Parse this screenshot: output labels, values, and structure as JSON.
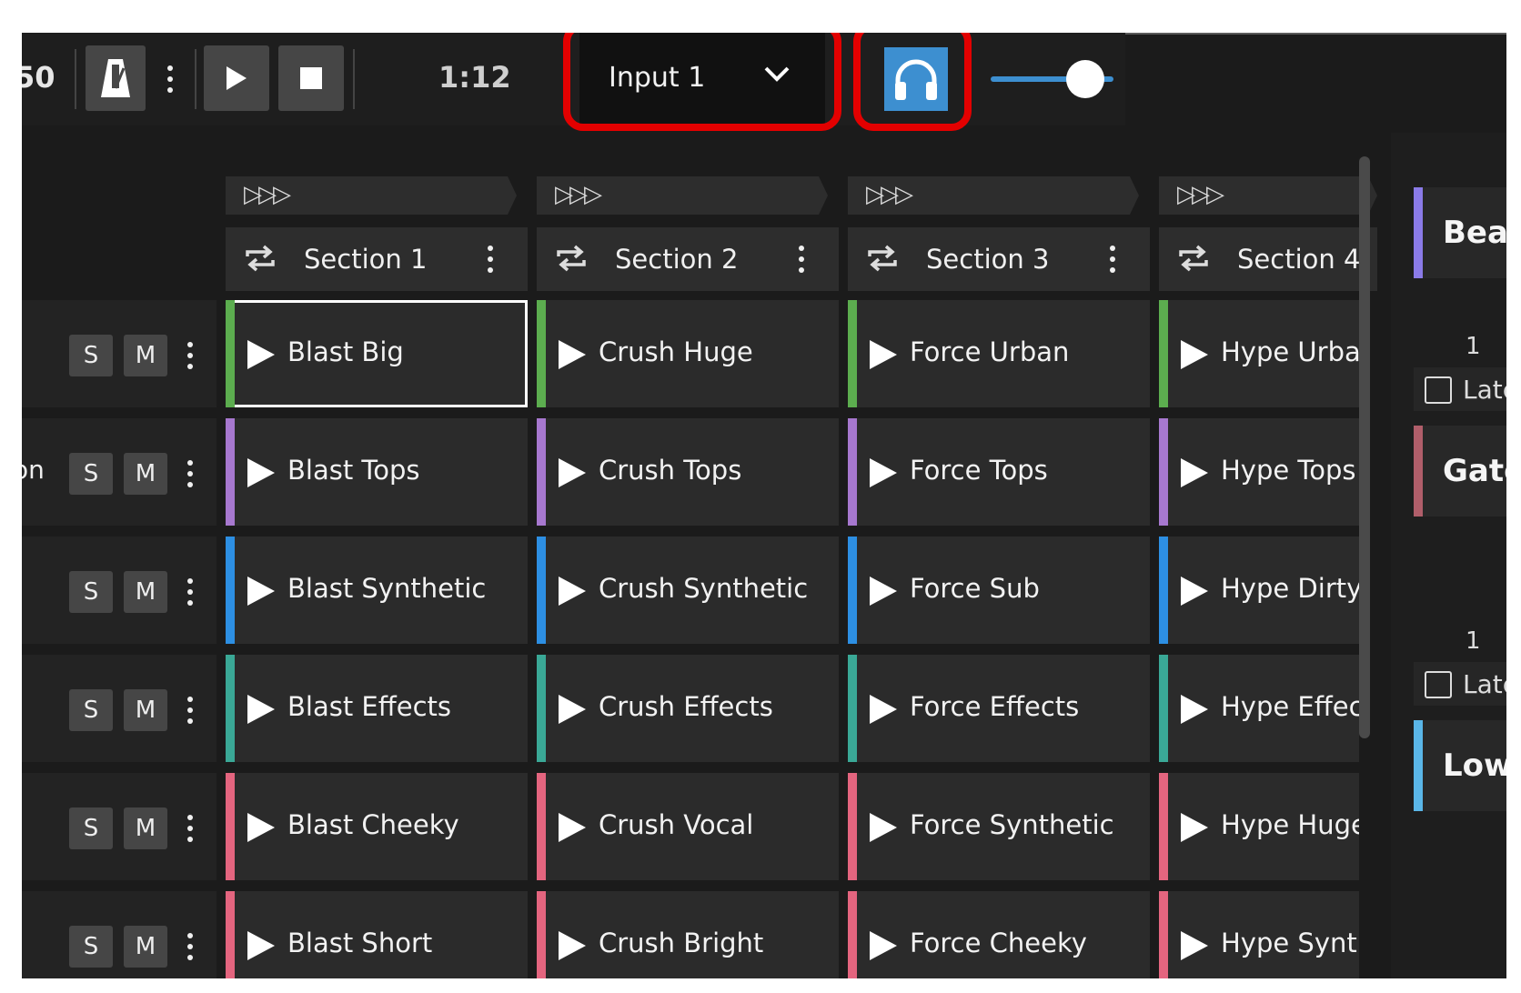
{
  "transport": {
    "tempo_partial": "50",
    "time": "1:12"
  },
  "input_select": {
    "value": "Input 1"
  },
  "sections": [
    {
      "label": "Section 1"
    },
    {
      "label": "Section 2"
    },
    {
      "label": "Section 3"
    },
    {
      "label": "Section 4"
    }
  ],
  "tracks": [
    {
      "name": "",
      "solo": "S",
      "mute": "M",
      "color": "#5cad4f",
      "clips": [
        "Blast Big",
        "Crush Huge",
        "Force Urban",
        "Hype Urban"
      ]
    },
    {
      "name": "on",
      "solo": "S",
      "mute": "M",
      "color": "#a778cf",
      "clips": [
        "Blast Tops",
        "Crush Tops",
        "Force Tops",
        "Hype Tops"
      ]
    },
    {
      "name": "",
      "solo": "S",
      "mute": "M",
      "color": "#2d8fe3",
      "clips": [
        "Blast Synthetic",
        "Crush Synthetic",
        "Force Sub",
        "Hype Dirty"
      ]
    },
    {
      "name": "",
      "solo": "S",
      "mute": "M",
      "color": "#3aa896",
      "clips": [
        "Blast Effects",
        "Crush Effects",
        "Force Effects",
        "Hype Effects"
      ]
    },
    {
      "name": "",
      "solo": "S",
      "mute": "M",
      "color": "#e4657f",
      "clips": [
        "Blast Cheeky",
        "Crush Vocal",
        "Force Synthetic",
        "Hype Huge"
      ]
    },
    {
      "name": "",
      "solo": "S",
      "mute": "M",
      "color": "#e4657f",
      "clips": [
        "Blast Short",
        "Crush Bright",
        "Force Cheeky",
        "Hype Synth"
      ]
    }
  ],
  "right_panel": {
    "cards": [
      {
        "label": "Beat",
        "color": "#8b7be8"
      },
      {
        "label": "Gate",
        "color": "#b05e6a"
      },
      {
        "label": "Low",
        "color": "#5ab6e8"
      }
    ],
    "numbers": [
      "1",
      "1"
    ],
    "latch_label": "Latch"
  },
  "colors": {
    "accent": "#3d8fd0",
    "highlight": "#e30000"
  }
}
